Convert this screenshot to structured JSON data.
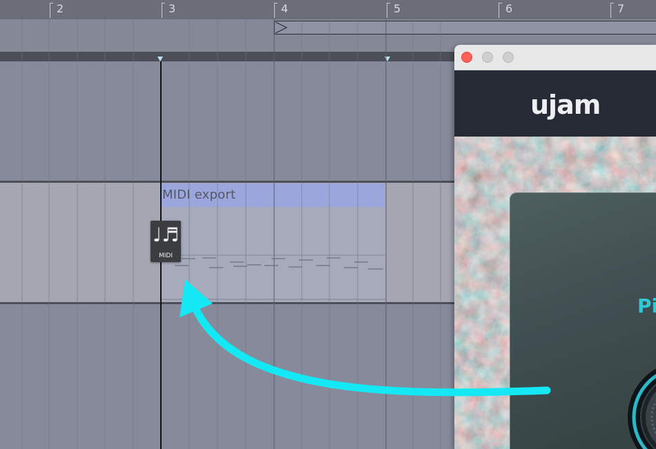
{
  "ruler": {
    "bars": [
      "2",
      "3",
      "4",
      "5",
      "6",
      "7"
    ]
  },
  "clip": {
    "name": "MIDI export"
  },
  "drag_file": {
    "icon": "music-notes-icon",
    "label": "MIDI"
  },
  "plugin_window": {
    "brand": "ujam",
    "product_partial": "Pi",
    "traffic_lights": {
      "close": "#fe5f57",
      "minimize": "#cfcfcf",
      "zoom": "#cfcfcf"
    }
  },
  "annotation": {
    "arrow_color": "#14e8f4",
    "icon": "curved-arrow-icon"
  },
  "colors": {
    "clip_header": "#9ba6dc",
    "playhead": "#111111",
    "accent": "#33c6d6"
  }
}
